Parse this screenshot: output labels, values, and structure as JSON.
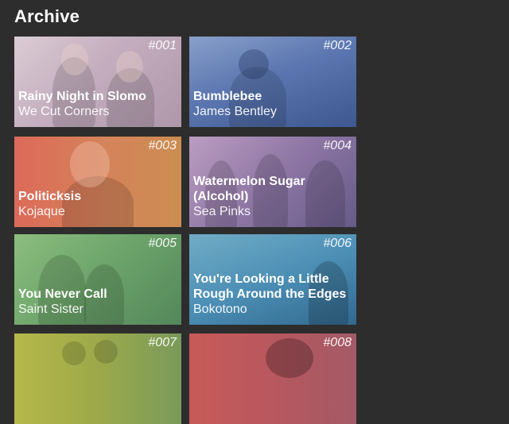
{
  "page": {
    "title": "Archive"
  },
  "cards": [
    {
      "number": "#001",
      "song": "Rainy Night in Slomo",
      "artist": "We Cut Corners",
      "tint": "#b9a2b4"
    },
    {
      "number": "#002",
      "song": "Bumblebee",
      "artist": "James Bentley",
      "tint": "#4f6fae"
    },
    {
      "number": "#003",
      "song": "Politicksis",
      "artist": "Kojaque",
      "tint": "#d66a57"
    },
    {
      "number": "#004",
      "song": "Watermelon Sugar (Alcohol)",
      "artist": "Sea Pinks",
      "tint": "#8a73a1"
    },
    {
      "number": "#005",
      "song": "You Never Call",
      "artist": "Saint Sister",
      "tint": "#71a76a"
    },
    {
      "number": "#006",
      "song": "You're Looking a Little Rough Around the Edges",
      "artist": "Bokotono",
      "tint": "#4c8fb7"
    },
    {
      "number": "#007",
      "song": "",
      "artist": "",
      "tint": "#9ca94a"
    },
    {
      "number": "#008",
      "song": "",
      "artist": "",
      "tint": "#b8585f"
    }
  ]
}
